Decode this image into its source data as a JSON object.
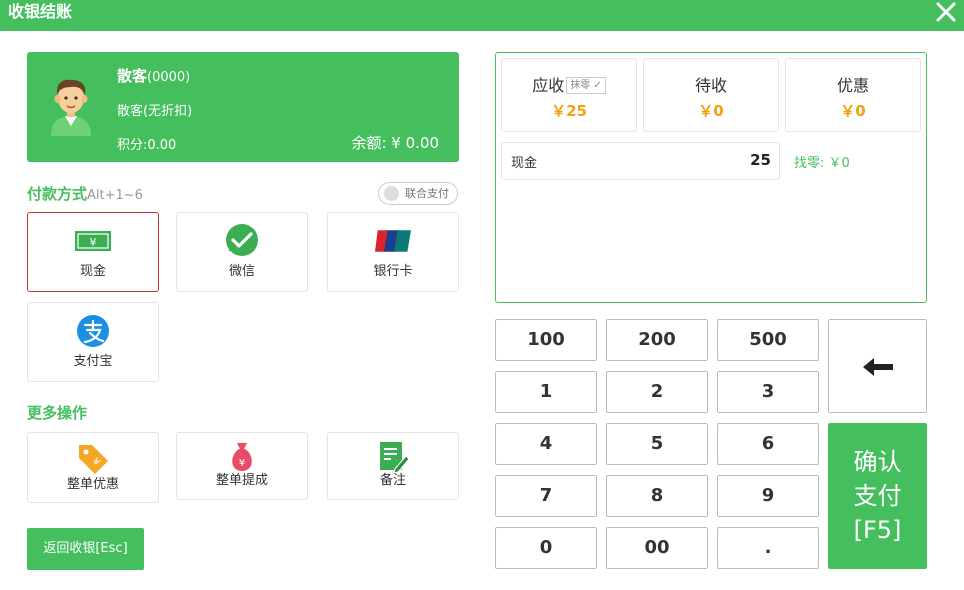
{
  "window": {
    "title": "收银结账"
  },
  "customer": {
    "name": "散客",
    "code": "(0000)",
    "level": "散客(无折扣)",
    "points": "积分:0.00",
    "balance": "余额: ¥ 0.00"
  },
  "payment": {
    "section_title": "付款方式",
    "shortcut_hint": "Alt+1~6",
    "combo_label": "联合支付",
    "methods": [
      {
        "label": "现金",
        "icon": "cash-icon"
      },
      {
        "label": "微信",
        "icon": "wechat-icon"
      },
      {
        "label": "银行卡",
        "icon": "unionpay-icon"
      },
      {
        "label": "支付宝",
        "icon": "alipay-icon"
      }
    ],
    "selected": "现金"
  },
  "more": {
    "section_title": "更多操作",
    "actions": [
      {
        "label": "整单优惠",
        "icon": "discount-tag-icon"
      },
      {
        "label": "整单提成",
        "icon": "money-bag-icon"
      },
      {
        "label": "备注",
        "icon": "note-icon"
      }
    ]
  },
  "back_button": "返回收银[Esc]",
  "summary": {
    "receivable_label": "应收",
    "erase_label": "抹零",
    "receivable_value": "￥25",
    "pending_label": "待收",
    "pending_value": "￥0",
    "discount_label": "优惠",
    "discount_value": "￥0"
  },
  "pay_line": {
    "method": "现金",
    "amount": "25",
    "change": "找零: ￥0"
  },
  "keypad": {
    "keys": [
      "100",
      "200",
      "500",
      "1",
      "2",
      "3",
      "4",
      "5",
      "6",
      "7",
      "8",
      "9",
      "0",
      "00",
      "."
    ],
    "confirm_lines": [
      "确认",
      "支付",
      "[F5]"
    ]
  },
  "colors": {
    "accent": "#45bf5e",
    "amount": "#f0a20f",
    "selected_border": "#c9332b"
  }
}
